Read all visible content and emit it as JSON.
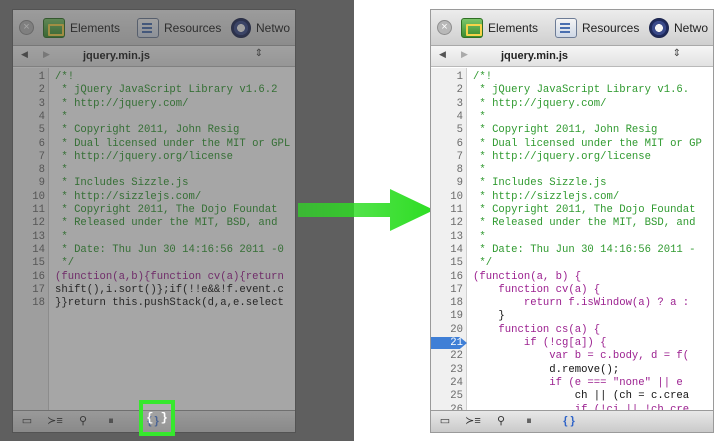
{
  "devtools": {
    "tabs": [
      {
        "label": "Elements",
        "icon": "elements-icon"
      },
      {
        "label": "Resources",
        "icon": "resources-icon"
      },
      {
        "label": "Netwo",
        "icon": "network-icon"
      }
    ],
    "file_name": "jquery.min.js",
    "status_buttons": [
      "console-toggle-icon",
      "console-icon",
      "search-icon",
      "pause-icon",
      "pretty-print-icon"
    ],
    "pretty_print_glyph": "{ }"
  },
  "colors": {
    "highlight": "#36e82d",
    "arrow": "#2ddd23",
    "comment": "#2f9a2f",
    "keyword": "#9b1f8f",
    "breakpoint": "#3f7fd6"
  },
  "left_code": [
    {
      "n": "1",
      "t": "/*!",
      "c": "cm"
    },
    {
      "n": "2",
      "t": " * jQuery JavaScript Library v1.6.2",
      "c": "cm"
    },
    {
      "n": "3",
      "t": " * http://jquery.com/",
      "c": "cm"
    },
    {
      "n": "4",
      "t": " *",
      "c": "cm"
    },
    {
      "n": "5",
      "t": " * Copyright 2011, John Resig",
      "c": "cm"
    },
    {
      "n": "6",
      "t": " * Dual licensed under the MIT or GPL",
      "c": "cm"
    },
    {
      "n": "7",
      "t": " * http://jquery.org/license",
      "c": "cm"
    },
    {
      "n": "8",
      "t": " *",
      "c": "cm"
    },
    {
      "n": "9",
      "t": " * Includes Sizzle.js",
      "c": "cm"
    },
    {
      "n": "10",
      "t": " * http://sizzlejs.com/",
      "c": "cm"
    },
    {
      "n": "11",
      "t": " * Copyright 2011, The Dojo Foundat",
      "c": "cm"
    },
    {
      "n": "12",
      "t": " * Released under the MIT, BSD, and",
      "c": "cm"
    },
    {
      "n": "13",
      "t": " *",
      "c": "cm"
    },
    {
      "n": "14",
      "t": " * Date: Thu Jun 30 14:16:56 2011 -0",
      "c": "cm"
    },
    {
      "n": "15",
      "t": " */",
      "c": "cm"
    },
    {
      "n": "16",
      "t": "(function(a,b){function cv(a){return",
      "c": "kw"
    },
    {
      "n": "17",
      "t": "shift(),i.sort()};if(!!e&&!f.event.c",
      "c": "pl"
    },
    {
      "n": "18",
      "t": "}}return this.pushStack(d,a,e.select",
      "c": "pl"
    }
  ],
  "right_code": [
    {
      "n": "1",
      "t": "/*!",
      "c": "cm"
    },
    {
      "n": "2",
      "t": " * jQuery JavaScript Library v1.6.",
      "c": "cm"
    },
    {
      "n": "3",
      "t": " * http://jquery.com/",
      "c": "cm"
    },
    {
      "n": "4",
      "t": " *",
      "c": "cm"
    },
    {
      "n": "5",
      "t": " * Copyright 2011, John Resig",
      "c": "cm"
    },
    {
      "n": "6",
      "t": " * Dual licensed under the MIT or GP",
      "c": "cm"
    },
    {
      "n": "7",
      "t": " * http://jquery.org/license",
      "c": "cm"
    },
    {
      "n": "8",
      "t": " *",
      "c": "cm"
    },
    {
      "n": "9",
      "t": " * Includes Sizzle.js",
      "c": "cm"
    },
    {
      "n": "10",
      "t": " * http://sizzlejs.com/",
      "c": "cm"
    },
    {
      "n": "11",
      "t": " * Copyright 2011, The Dojo Foundat",
      "c": "cm"
    },
    {
      "n": "12",
      "t": " * Released under the MIT, BSD, and",
      "c": "cm"
    },
    {
      "n": "13",
      "t": " *",
      "c": "cm"
    },
    {
      "n": "14",
      "t": " * Date: Thu Jun 30 14:16:56 2011 -",
      "c": "cm"
    },
    {
      "n": "15",
      "t": " */",
      "c": "cm"
    },
    {
      "n": "16",
      "t": "(function(a, b) {",
      "c": "kw"
    },
    {
      "n": "17",
      "t": "    function cv(a) {",
      "c": "kw"
    },
    {
      "n": "18",
      "t": "        return f.isWindow(a) ? a :",
      "c": "kw"
    },
    {
      "n": "19",
      "t": "    }",
      "c": "pl"
    },
    {
      "n": "20",
      "t": "    function cs(a) {",
      "c": "kw"
    },
    {
      "n": "21",
      "t": "        if (!cg[a]) {",
      "c": "kw",
      "bp": true
    },
    {
      "n": "22",
      "t": "            var b = c.body, d = f(",
      "c": "kw"
    },
    {
      "n": "23",
      "t": "            d.remove();",
      "c": "pl"
    },
    {
      "n": "24",
      "t": "            if (e === \"none\" || e",
      "c": "kw"
    },
    {
      "n": "25",
      "t": "                ch || (ch = c.crea",
      "c": "pl"
    },
    {
      "n": "26",
      "t": "                if (!ci || !ch.cre",
      "c": "kw"
    }
  ]
}
